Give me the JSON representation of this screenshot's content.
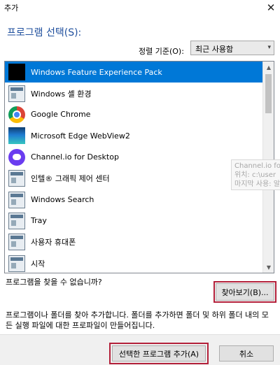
{
  "window": {
    "title": "추가",
    "close_glyph": "✕"
  },
  "heading": "프로그램 선택(S):",
  "sort": {
    "label": "정렬 기준(O):",
    "value": "최근 사용함",
    "arrow": "▾"
  },
  "programs": [
    {
      "label": "Windows Feature Experience Pack",
      "icon": "black-square-icon",
      "selected": true
    },
    {
      "label": "Windows 셸 환경",
      "icon": "app-window-icon"
    },
    {
      "label": "Google Chrome",
      "icon": "chrome-icon"
    },
    {
      "label": "Microsoft Edge WebView2",
      "icon": "edge-webview-icon"
    },
    {
      "label": "Channel.io for Desktop",
      "icon": "channel-io-icon"
    },
    {
      "label": "인텔® 그래픽 제어 센터",
      "icon": "app-window-icon"
    },
    {
      "label": "Windows Search",
      "icon": "app-window-icon"
    },
    {
      "label": "Tray",
      "icon": "app-window-icon"
    },
    {
      "label": "사용자 휴대폰",
      "icon": "app-window-icon"
    },
    {
      "label": "시작",
      "icon": "app-window-icon"
    }
  ],
  "scrollbar": {
    "up_glyph": "▲",
    "down_glyph": "▼"
  },
  "tooltip": {
    "line1": "Channel.io for",
    "line2": "위치: c:\\user",
    "line3": "마지막 사용: 알"
  },
  "not_found": "프로그램을 찾을 수 없습니까?",
  "browse_button": "찾아보기(B)...",
  "description": "프로그램이나 폴더를 찾아 추가합니다. 폴더를 추가하면 폴더 및 하위 폴더 내의 모든 실행 파일에 대한 프로파일이 만들어집니다.",
  "add_button": "선택한 프로그램 추가(A)",
  "cancel_button": "취소",
  "colors": {
    "selection": "#0078d7",
    "heading": "#1f4f9d",
    "highlight_outline": "#b3203a"
  }
}
